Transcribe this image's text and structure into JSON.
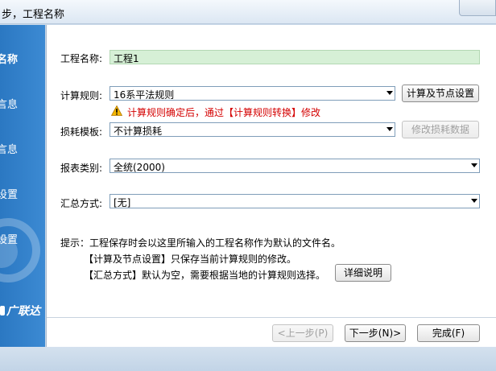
{
  "window": {
    "title": "步，工程名称"
  },
  "sidebar": {
    "items": [
      {
        "label": "名称",
        "active": true
      },
      {
        "label": "言息",
        "active": false
      },
      {
        "label": "言息",
        "active": false
      },
      {
        "label": "设置",
        "active": false
      },
      {
        "label": "设置",
        "active": false
      }
    ],
    "brand": "广联达"
  },
  "form": {
    "project_name_label": "工程名称:",
    "project_name_value": "工程1",
    "calc_rule_label": "计算规则:",
    "calc_rule_value": "16系平法规则",
    "calc_node_button": "计算及节点设置",
    "warning_text": "计算规则确定后，通过【计算规则转换】修改",
    "loss_template_label": "损耗模板:",
    "loss_template_value": "不计算损耗",
    "loss_data_button": "修改损耗数据",
    "report_type_label": "报表类别:",
    "report_type_value": "全统(2000)",
    "summary_label": "汇总方式:",
    "summary_value": "[无]"
  },
  "hints": {
    "line1": "提示：工程保存时会以这里所输入的工程名称作为默认的文件名。",
    "line2": "【计算及节点设置】只保存当前计算规则的修改。",
    "line3": "【汇总方式】默认为空，需要根据当地的计算规则选择。",
    "detail_button": "详细说明"
  },
  "footer": {
    "prev_button": "<上一步(P)",
    "next_button": "下一步(N)>",
    "finish_button": "完成(F)"
  },
  "colors": {
    "sidebar": "#2b78c2",
    "warning": "#d40000",
    "name_field": "#d6f0d6"
  }
}
